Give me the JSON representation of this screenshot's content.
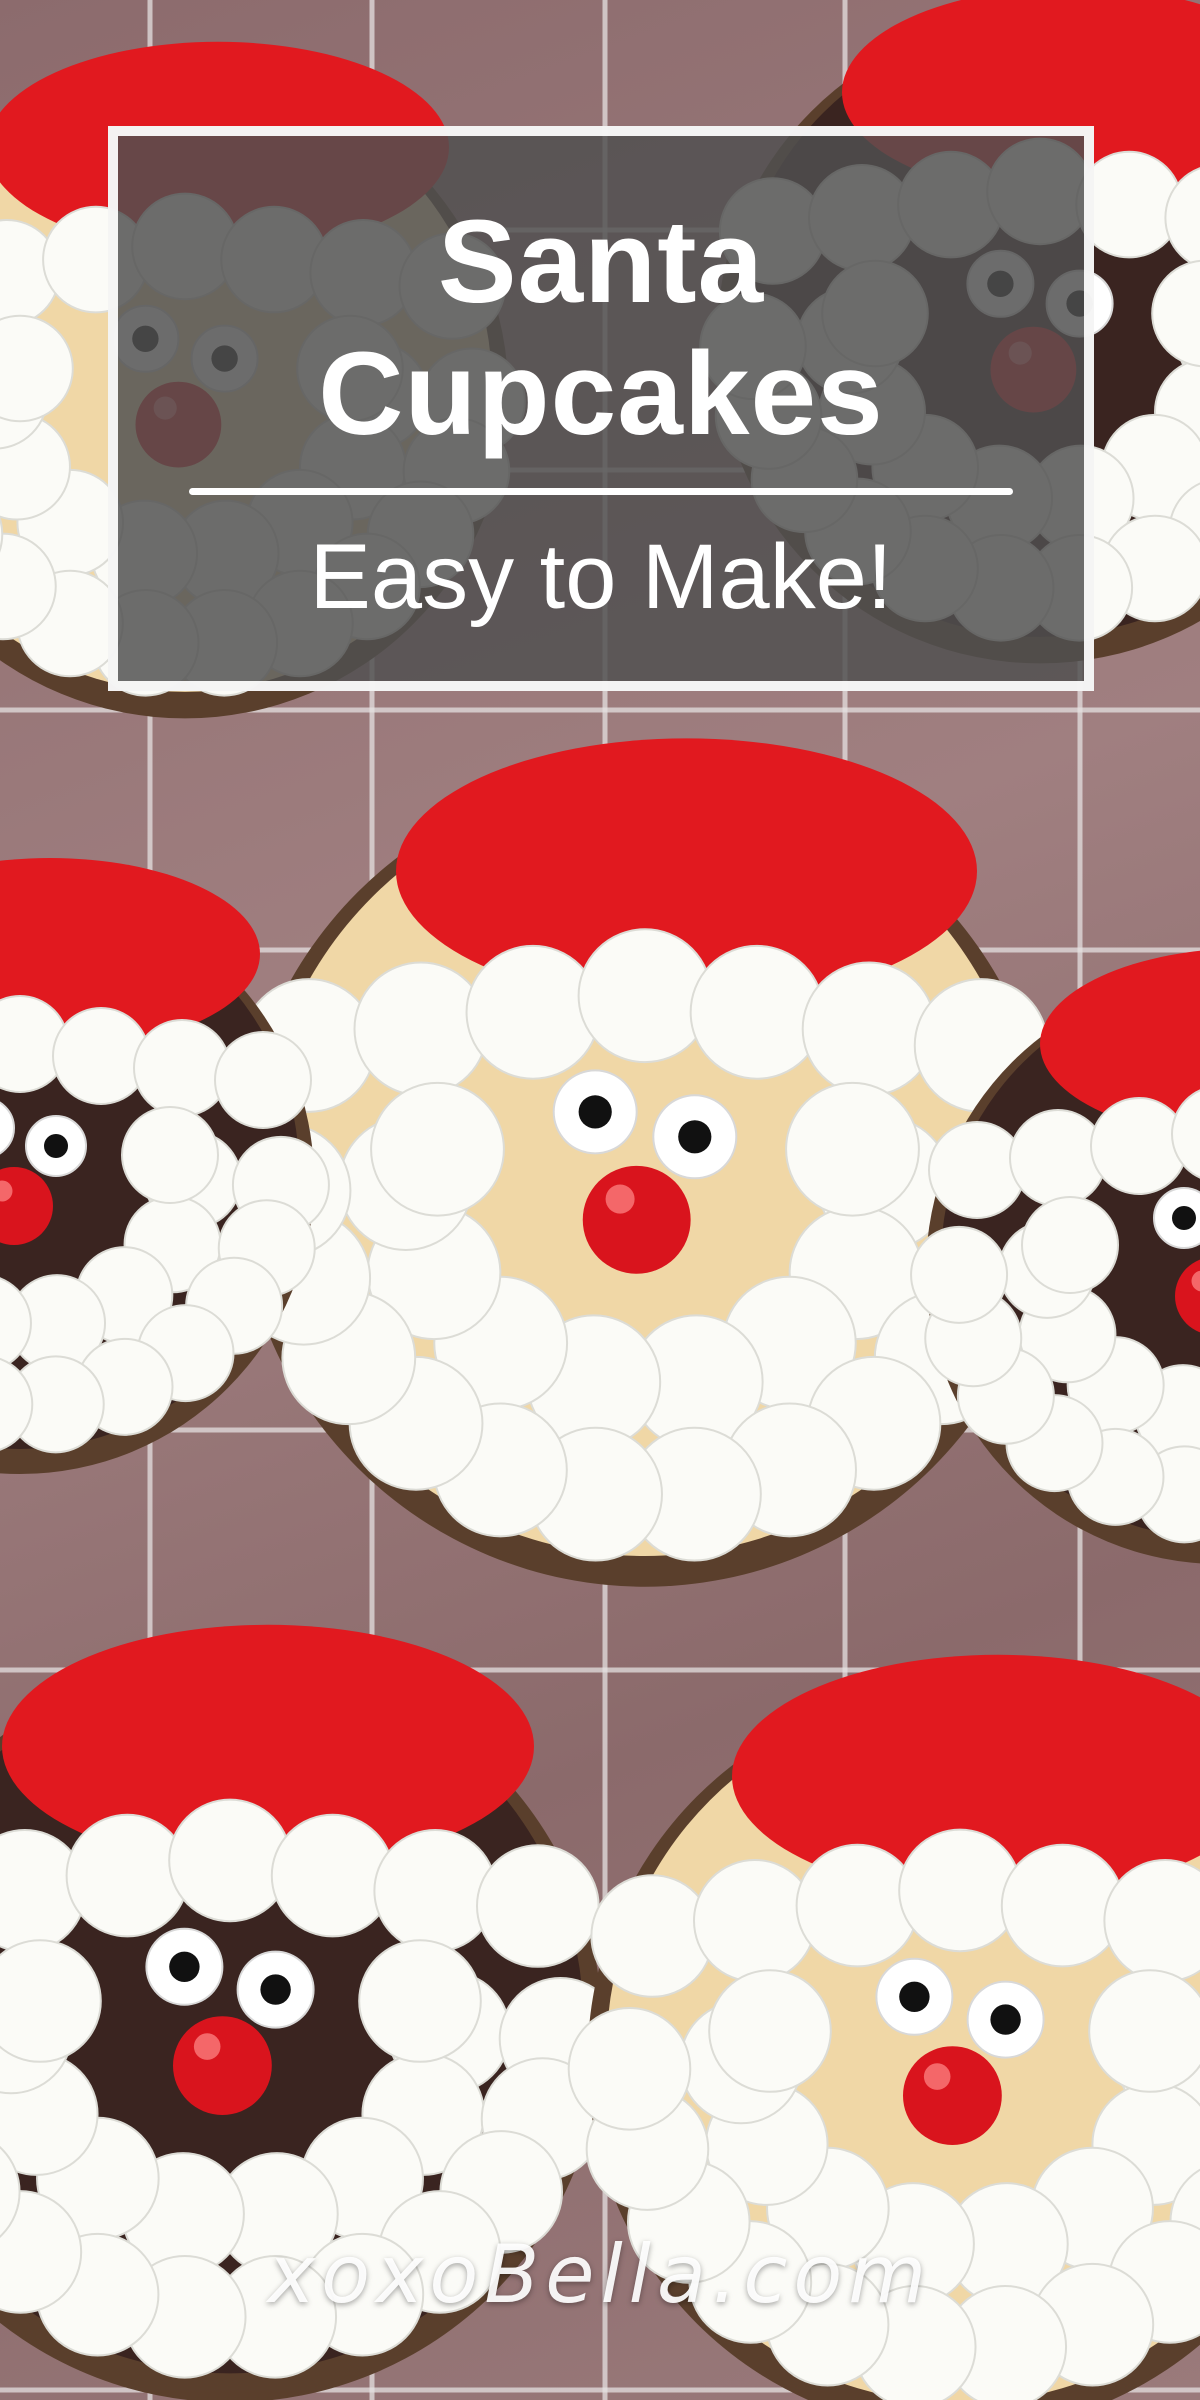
{
  "title_line1": "Santa",
  "title_line2": "Cupcakes",
  "subtitle": "Easy to Make!",
  "watermark": "xoxoBella.com",
  "colors": {
    "frosting_red": "#e1191f",
    "marshmallow": "#fbfbf7",
    "candy_nose": "#d9141d",
    "panel": "#505050",
    "rack": "#e6e6e6"
  },
  "cupcakes": [
    {
      "name": "top-left",
      "cake": "vanilla"
    },
    {
      "name": "top-right",
      "cake": "chocolate"
    },
    {
      "name": "middle-center",
      "cake": "vanilla"
    },
    {
      "name": "middle-left",
      "cake": "chocolate"
    },
    {
      "name": "middle-right",
      "cake": "chocolate"
    },
    {
      "name": "bottom-left",
      "cake": "chocolate"
    },
    {
      "name": "bottom-right",
      "cake": "vanilla"
    }
  ]
}
